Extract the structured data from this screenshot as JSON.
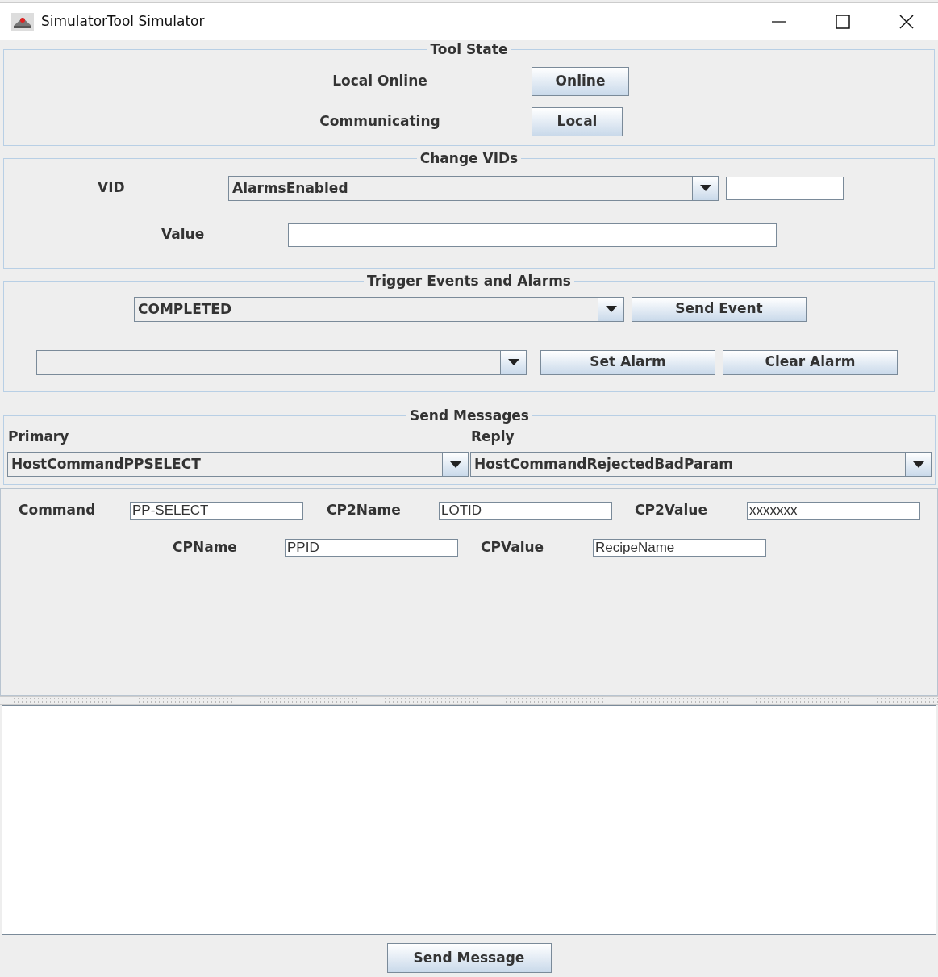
{
  "window": {
    "title": "SimulatorTool Simulator"
  },
  "tool_state": {
    "title": "Tool State",
    "rows": [
      {
        "label": "Local Online",
        "button": "Online"
      },
      {
        "label": "Communicating",
        "button": "Local"
      }
    ]
  },
  "change_vids": {
    "title": "Change VIDs",
    "vid_label": "VID",
    "vid_value": "AlarmsEnabled",
    "value_label": "Value"
  },
  "trigger": {
    "title": "Trigger Events and Alarms",
    "event_value": "COMPLETED",
    "send_event": "Send Event",
    "set_alarm": "Set Alarm",
    "clear_alarm": "Clear Alarm"
  },
  "send_messages": {
    "title": "Send Messages",
    "primary_label": "Primary",
    "primary_value": "HostCommandPPSELECT",
    "reply_label": "Reply",
    "reply_value": "HostCommandRejectedBadParam"
  },
  "params": [
    [
      {
        "label": "Command",
        "value": "PP-SELECT"
      },
      {
        "label": "CP2Name",
        "value": "LOTID"
      },
      {
        "label": "CP2Value",
        "value": "xxxxxxx"
      }
    ],
    [
      {
        "label": "CPName",
        "value": "PPID"
      },
      {
        "label": "CPValue",
        "value": "RecipeName"
      }
    ]
  ],
  "send_button": "Send Message"
}
